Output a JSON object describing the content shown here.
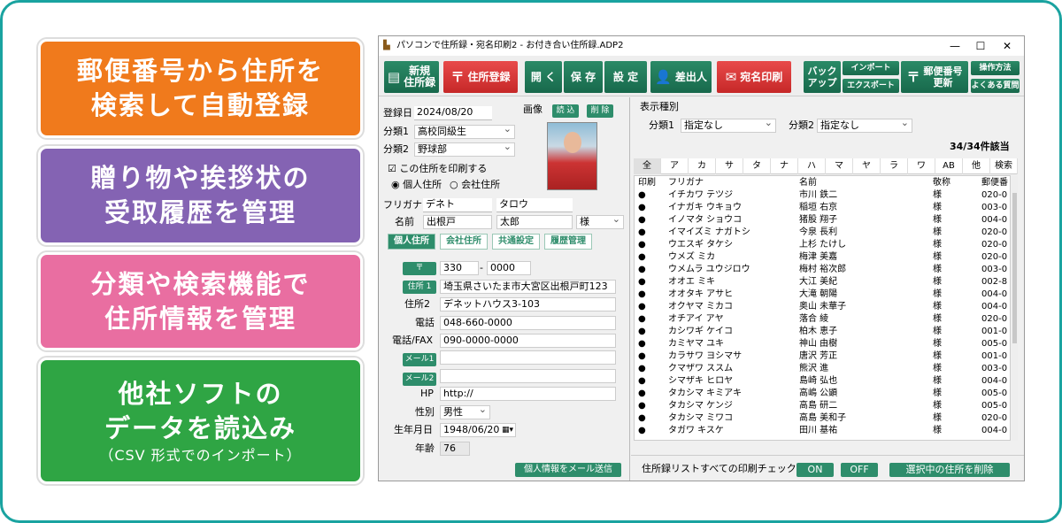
{
  "promo": [
    {
      "lines": [
        "郵便番号から住所を",
        "検索して自動登録"
      ]
    },
    {
      "lines": [
        "贈り物や挨拶状の",
        "受取履歴を管理"
      ]
    },
    {
      "lines": [
        "分類や検索機能で",
        "住所情報を管理"
      ]
    },
    {
      "lines": [
        "他社ソフトの",
        "データを読込み"
      ],
      "sub": "（CSV 形式でのインポート）"
    }
  ],
  "window": {
    "title": "パソコンで住所録・宛名印刷2 - お付き合い住所録.ADP2",
    "min": "—",
    "max": "☐",
    "close": "✕"
  },
  "toolbar": {
    "new": "新規\n住所録",
    "register": "住所登録",
    "open": "開 く",
    "save": "保 存",
    "settings": "設 定",
    "sender": "差出人",
    "print": "宛名印刷",
    "backup": "バック\nアップ",
    "import": "インポート",
    "export": "エクスポート",
    "postal": "郵便番号\n更新",
    "howto": "操作方法",
    "faq": "よくある質問"
  },
  "form": {
    "reg_label": "登録日",
    "reg_value": "2024/08/20",
    "cat1_label": "分類1",
    "cat1_value": "高校同級生",
    "cat2_label": "分類2",
    "cat2_value": "野球部",
    "image_label": "画像",
    "image_load": "読 込",
    "image_delete": "削 除",
    "print_check": "この住所を印刷する",
    "radio_personal": "個人住所",
    "radio_company": "会社住所",
    "furigana_label": "フリガナ",
    "furigana_last": "デネト",
    "furigana_first": "タロウ",
    "name_label": "名前",
    "name_last": "出根戸",
    "name_first": "太郎",
    "honorific": "様",
    "tabs": [
      "個人住所",
      "会社住所",
      "共通設定",
      "履歴管理"
    ],
    "zip_btn": "〒",
    "zip1": "330",
    "zip_dash": "-",
    "zip2": "0000",
    "addr1_btn": "住所 1",
    "addr1": "埼玉県さいたま市大宮区出根戸町123",
    "addr2_label": "住所2",
    "addr2": "デネットハウス3-103",
    "tel_label": "電話",
    "tel": "048-660-0000",
    "fax_label": "電話/FAX",
    "fax": "090-0000-0000",
    "mail1_btn": "メール1",
    "mail1": "",
    "mail2_btn": "メール2",
    "mail2": "",
    "hp_label": "HP",
    "hp": "http://",
    "sex_label": "性別",
    "sex": "男性",
    "birth_label": "生年月日",
    "birth": "1948/06/20",
    "age_label": "年齢",
    "age": "76",
    "send_mail": "個人情報をメール送信"
  },
  "filter": {
    "title": "表示種別",
    "cat1_label": "分類1",
    "cat1": "指定なし",
    "cat2_label": "分類2",
    "cat2": "指定なし",
    "count": "34/34件該当"
  },
  "kana": [
    "全",
    "ア",
    "カ",
    "サ",
    "タ",
    "ナ",
    "ハ",
    "マ",
    "ヤ",
    "ラ",
    "ワ",
    "AB",
    "他",
    "検索"
  ],
  "list": {
    "headers": [
      "印刷",
      "フリガナ",
      "名前",
      "敬称",
      "郵便番"
    ],
    "rows": [
      [
        "●",
        "イチカワ テツジ",
        "市川 鉄二",
        "様",
        "020-0"
      ],
      [
        "●",
        "イナガキ ウキョウ",
        "稲垣 右京",
        "様",
        "003-0"
      ],
      [
        "●",
        "イノマタ ショウコ",
        "猪股 翔子",
        "様",
        "004-0"
      ],
      [
        "●",
        "イマイズミ ナガトシ",
        "今泉 長利",
        "様",
        "020-0"
      ],
      [
        "●",
        "ウエスギ タケシ",
        "上杉 たけし",
        "様",
        "020-0"
      ],
      [
        "●",
        "ウメズ ミカ",
        "梅津 美嘉",
        "様",
        "020-0"
      ],
      [
        "●",
        "ウメムラ ユウジロウ",
        "梅村 裕次郎",
        "様",
        "003-0"
      ],
      [
        "●",
        "オオエ ミキ",
        "大江 美紀",
        "様",
        "002-8"
      ],
      [
        "●",
        "オオタキ アサヒ",
        "大滝 朝陽",
        "様",
        "004-0"
      ],
      [
        "●",
        "オクヤマ ミカコ",
        "奥山 未華子",
        "様",
        "004-0"
      ],
      [
        "●",
        "オチアイ アヤ",
        "落合 綾",
        "様",
        "020-0"
      ],
      [
        "●",
        "カシワギ ケイコ",
        "柏木 恵子",
        "様",
        "001-0"
      ],
      [
        "●",
        "カミヤマ ユキ",
        "神山 由樹",
        "様",
        "005-0"
      ],
      [
        "●",
        "カラサワ ヨシマサ",
        "唐沢 芳正",
        "様",
        "001-0"
      ],
      [
        "●",
        "クマザワ ススム",
        "熊沢 進",
        "様",
        "003-0"
      ],
      [
        "●",
        "シマザキ ヒロヤ",
        "島崎 弘也",
        "様",
        "004-0"
      ],
      [
        "●",
        "タカシマ キミアキ",
        "高嶋 公顕",
        "様",
        "005-0"
      ],
      [
        "●",
        "タカシマ ケンジ",
        "高島 研二",
        "様",
        "005-0"
      ],
      [
        "●",
        "タカシマ ミワコ",
        "高島 美和子",
        "様",
        "020-0"
      ],
      [
        "●",
        "タガワ キスケ",
        "田川 基祐",
        "様",
        "004-0"
      ]
    ]
  },
  "bottom": {
    "label": "住所録リストすべての印刷チェック:",
    "on": "ON",
    "off": "OFF",
    "delete": "選択中の住所を削除"
  },
  "colors": {
    "accent": "#2e8d6b",
    "red": "#c62828",
    "frame": "#1aa3a0"
  }
}
